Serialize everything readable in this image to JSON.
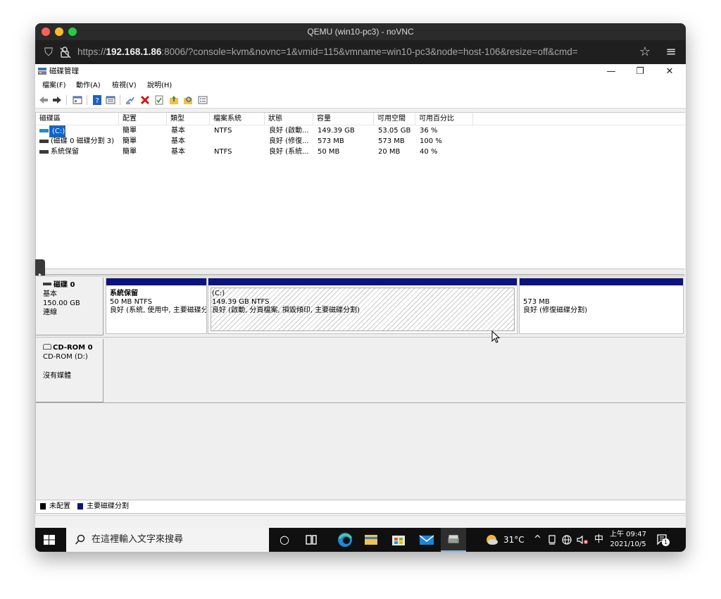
{
  "browser": {
    "title": "QEMU (win10-pc3) - noVNC",
    "url_prefix": "https://",
    "url_host": "192.168.1.86",
    "url_rest": ":8006/?console=kvm&novnc=1&vmid=115&vmname=win10-pc3&node=host-106&resize=off&cmd="
  },
  "app": {
    "title": "磁碟管理",
    "window_buttons": {
      "minimize": "—",
      "restore": "❐",
      "close": "✕"
    }
  },
  "menu": [
    "檔案(F)",
    "動作(A)",
    "檢視(V)",
    "說明(H)"
  ],
  "list": {
    "columns": [
      "磁碟區",
      "配置",
      "類型",
      "檔案系統",
      "狀態",
      "容量",
      "可用空間",
      "可用百分比"
    ],
    "rows": [
      {
        "volume": "(C:)",
        "layout": "簡單",
        "type": "基本",
        "fs": "NTFS",
        "status": "良好 (啟動...",
        "capacity": "149.39 GB",
        "free": "53.05 GB",
        "pct": "36 %"
      },
      {
        "volume": "(磁碟 0 磁碟分割 3)",
        "layout": "簡單",
        "type": "基本",
        "fs": "",
        "status": "良好 (修復...",
        "capacity": "573 MB",
        "free": "573 MB",
        "pct": "100 %"
      },
      {
        "volume": "系統保留",
        "layout": "簡單",
        "type": "基本",
        "fs": "NTFS",
        "status": "良好 (系統...",
        "capacity": "50 MB",
        "free": "20 MB",
        "pct": "40 %"
      }
    ]
  },
  "disks": {
    "disk0": {
      "name": "磁碟 0",
      "type": "基本",
      "size": "150.00 GB",
      "state": "連線"
    },
    "partitions": [
      {
        "name": "系統保留",
        "size": "50 MB NTFS",
        "status": "良好 (系統, 使用中, 主要磁碟分割)"
      },
      {
        "name": "(C:)",
        "size": "149.39 GB NTFS",
        "status": "良好 (啟動, 分頁檔案, 損毀傾印, 主要磁碟分割)"
      },
      {
        "name": "",
        "size": "573 MB",
        "status": "良好 (修復磁碟分割)"
      }
    ],
    "cdrom": {
      "name": "CD-ROM 0",
      "drive": "CD-ROM (D:)",
      "state": "沒有媒體"
    }
  },
  "legend": {
    "unallocated": "未配置",
    "primary": "主要磁碟分割"
  },
  "taskbar": {
    "search_placeholder": "在這裡輸入文字來搜尋",
    "weather": "31°C",
    "ime": "中",
    "time": "上午 09:47",
    "date": "2021/10/5",
    "notification_count": "1"
  },
  "colors": {
    "partition_stripe": "#0b1380",
    "taskbar": "#101010",
    "titlebar": "#2b2b2b"
  }
}
